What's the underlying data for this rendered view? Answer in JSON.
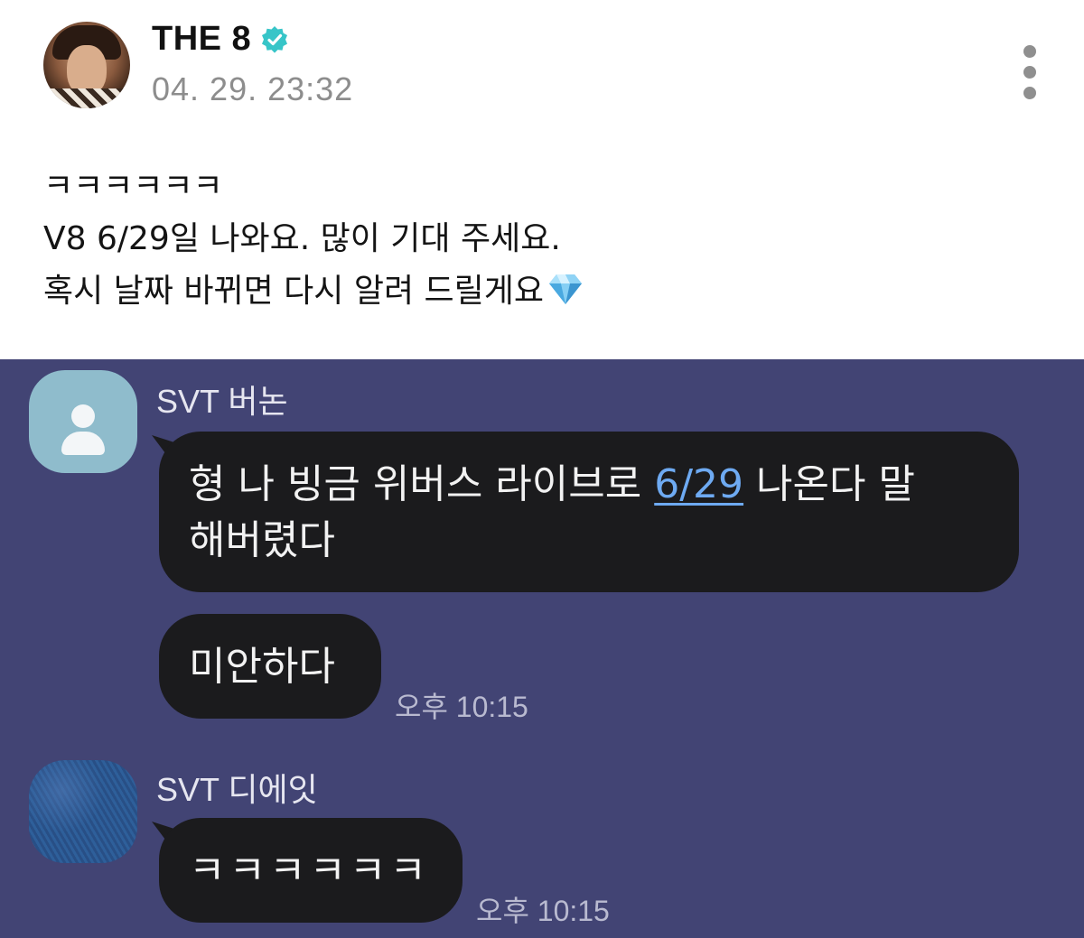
{
  "post": {
    "author": "THE 8",
    "timestamp": "04. 29. 23:32",
    "lines": [
      "ㅋㅋㅋㅋㅋㅋ",
      "V8 6/29일 나와요. 많이 기대 주세요.",
      "혹시 날짜 바뀌면 다시 알려 드릴게요"
    ],
    "emoji": "diamond-icon"
  },
  "chat": {
    "messages": [
      {
        "sender": "SVT 버논",
        "bubble1": {
          "line1_before": "형 나 빙금 위버스 라이브로 ",
          "link": "6/29",
          "line1_after": " 나온다 말",
          "line2": "해버렸다"
        },
        "bubble2": "미안하다",
        "time": "오후 10:15"
      },
      {
        "sender": "SVT 디에잇",
        "bubble1": "ㅋㅋㅋㅋㅋㅋ",
        "time": "오후 10:15"
      }
    ]
  },
  "colors": {
    "chat_background": "#424474",
    "bubble": "#1b1b1d",
    "link": "#6eaaf2",
    "verified": "#37c5c8"
  }
}
